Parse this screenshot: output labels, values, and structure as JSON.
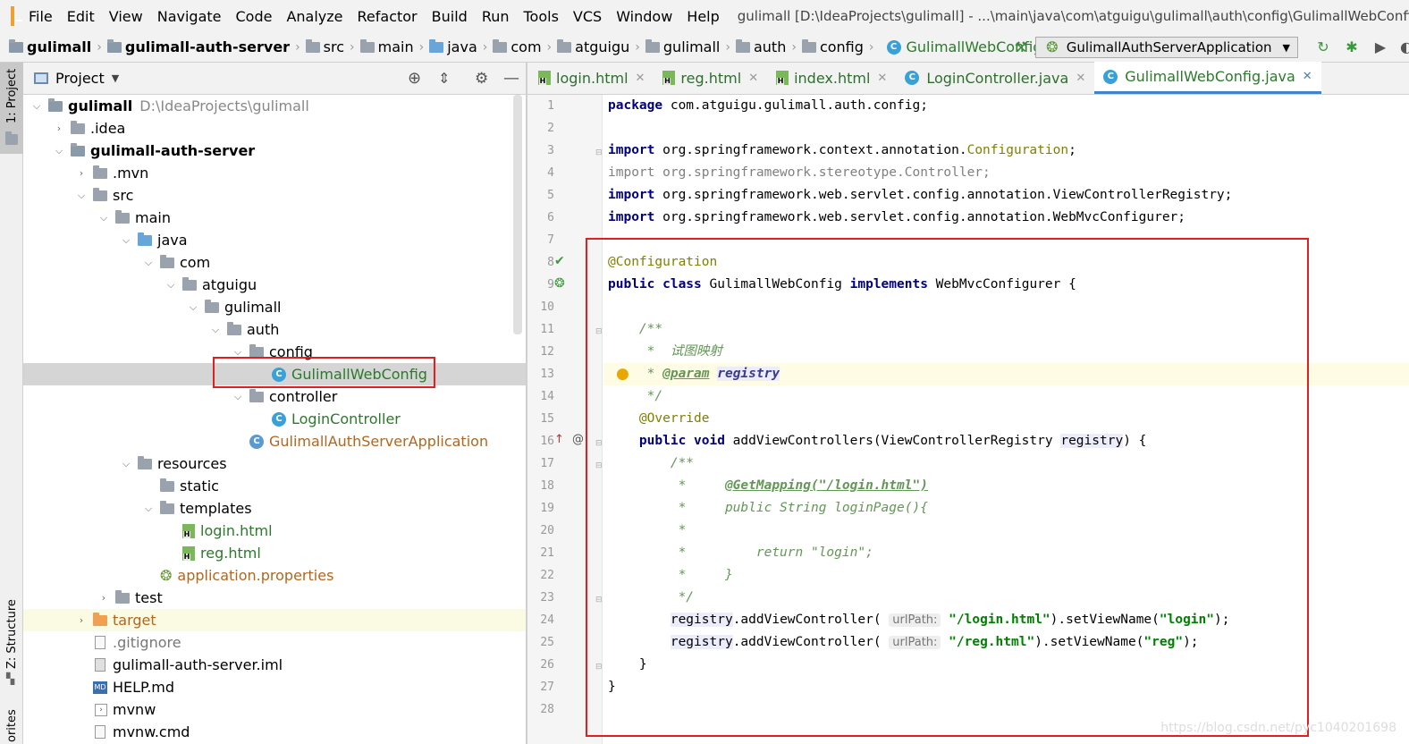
{
  "menubar": {
    "items": [
      "File",
      "Edit",
      "View",
      "Navigate",
      "Code",
      "Analyze",
      "Refactor",
      "Build",
      "Run",
      "Tools",
      "VCS",
      "Window",
      "Help"
    ],
    "window_title": "gulimall [D:\\IdeaProjects\\gulimall] - ...\\main\\java\\com\\atguigu\\gulimall\\auth\\config\\GulimallWebConfig.java"
  },
  "navbar": {
    "crumbs": [
      "gulimall",
      "gulimall-auth-server",
      "src",
      "main",
      "java",
      "com",
      "atguigu",
      "gulimall",
      "auth",
      "config",
      "GulimallWebConfig"
    ],
    "run_config": "GulimallAuthServerApplication"
  },
  "sidebar": {
    "project_tab": "1: Project",
    "structure_tab": "Z: Structure",
    "favorites_tab": "orites"
  },
  "project": {
    "title": "Project",
    "tree": [
      {
        "label": "gulimall",
        "extra": "D:\\IdeaProjects\\gulimall",
        "bold": true
      },
      {
        "label": ".idea"
      },
      {
        "label": "gulimall-auth-server",
        "bold": true
      },
      {
        "label": ".mvn"
      },
      {
        "label": "src"
      },
      {
        "label": "main"
      },
      {
        "label": "java"
      },
      {
        "label": "com"
      },
      {
        "label": "atguigu"
      },
      {
        "label": "gulimall"
      },
      {
        "label": "auth"
      },
      {
        "label": "config"
      },
      {
        "label": "GulimallWebConfig"
      },
      {
        "label": "controller"
      },
      {
        "label": "LoginController"
      },
      {
        "label": "GulimallAuthServerApplication"
      },
      {
        "label": "resources"
      },
      {
        "label": "static"
      },
      {
        "label": "templates"
      },
      {
        "label": "login.html"
      },
      {
        "label": "reg.html"
      },
      {
        "label": "application.properties"
      },
      {
        "label": "test"
      },
      {
        "label": "target"
      },
      {
        "label": ".gitignore"
      },
      {
        "label": "gulimall-auth-server.iml"
      },
      {
        "label": "HELP.md"
      },
      {
        "label": "mvnw"
      },
      {
        "label": "mvnw.cmd"
      }
    ]
  },
  "editor": {
    "tabs": [
      "login.html",
      "reg.html",
      "index.html",
      "LoginController.java",
      "GulimallWebConfig.java"
    ],
    "line_numbers": [
      "1",
      "2",
      "3",
      "4",
      "5",
      "6",
      "7",
      "8",
      "9",
      "10",
      "11",
      "12",
      "13",
      "14",
      "15",
      "16",
      "17",
      "18",
      "19",
      "20",
      "21",
      "22",
      "23",
      "24",
      "25",
      "26",
      "27",
      "28"
    ],
    "code": {
      "l1_kw": "package",
      "l1_rest": " com.atguigu.gulimall.auth.config;",
      "l3_kw": "import",
      "l3_a": " org.springframework.context.annotation.",
      "l3_b": "Configuration",
      "l3_c": ";",
      "l4": "import org.springframework.stereotype.Controller;",
      "l5_kw": "import",
      "l5_rest": " org.springframework.web.servlet.config.annotation.ViewControllerRegistry;",
      "l6_kw": "import",
      "l6_rest": " org.springframework.web.servlet.config.annotation.WebMvcConfigurer;",
      "l8": "@Configuration",
      "l9_kw1": "public class",
      "l9_a": " GulimallWebConfig ",
      "l9_kw2": "implements",
      "l9_b": " WebMvcConfigurer {",
      "l11": "    /**",
      "l12": "     *  试图映射",
      "l13_a": "     * ",
      "l13_tag": "@param",
      "l13_b": " ",
      "l13_p": "registry",
      "l14": "     */",
      "l15": "    @Override",
      "l16_kw": "    public void",
      "l16_a": " addViewControllers(ViewControllerRegistry ",
      "l16_p": "registry",
      "l16_b": ") {",
      "l17": "        /**",
      "l18_a": "         *     ",
      "l18_tag": "@GetMapping(\"/login.html\")",
      "l19": "         *     public String loginPage(){",
      "l20": "         *",
      "l21": "         *         return \"login\";",
      "l22": "         *     }",
      "l23": "         */",
      "l24_a": "        ",
      "l24_p": "registry",
      "l24_b": ".addViewController( ",
      "l24_hint": "urlPath:",
      "l24_s1": "\"/login.html\"",
      "l24_c": ").setViewName(",
      "l24_s2": "\"login\"",
      "l24_d": ");",
      "l25_a": "        ",
      "l25_p": "registry",
      "l25_b": ".addViewController( ",
      "l25_hint": "urlPath:",
      "l25_s1": "\"/reg.html\"",
      "l25_c": ").setViewName(",
      "l25_s2": "\"reg\"",
      "l25_d": ");",
      "l26": "    }",
      "l27": "}"
    }
  },
  "watermark": "https://blog.csdn.net/pyc1040201698",
  "colors": {
    "highlight_border": "#e02020",
    "accent": "#4083c9",
    "keyword": "#000080",
    "string": "#008000",
    "annotation": "#808000"
  }
}
